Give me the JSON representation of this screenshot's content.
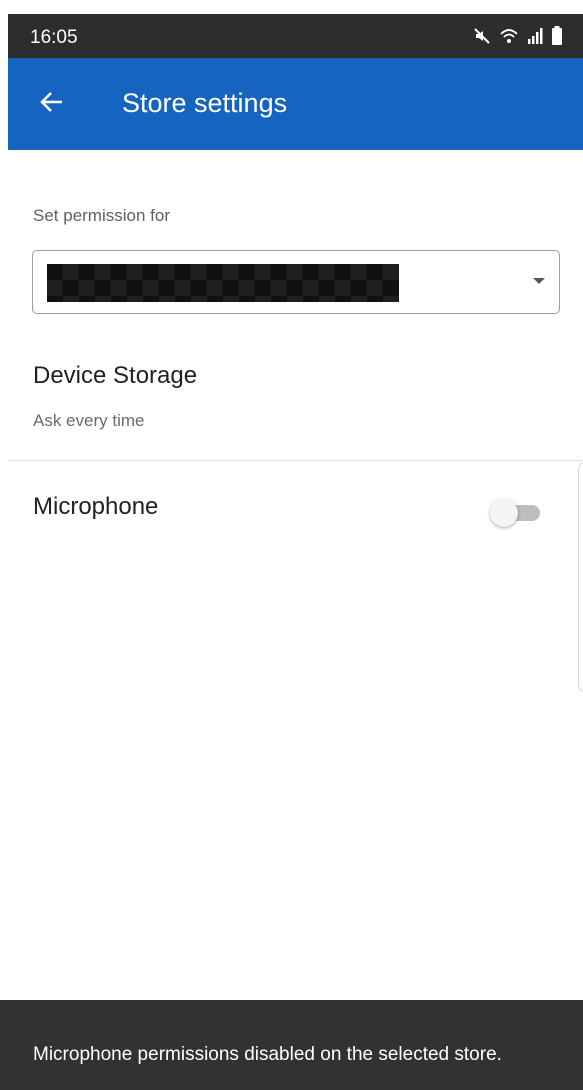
{
  "status_bar": {
    "time": "16:05",
    "icons": [
      "mute-icon",
      "wifi-icon",
      "signal-icon",
      "battery-icon"
    ]
  },
  "app_bar": {
    "title": "Store settings",
    "back_icon": "arrow-back-icon",
    "color": "#1565c0"
  },
  "permission": {
    "label": "Set permission for",
    "selected_store": "",
    "selected_store_redacted": true
  },
  "settings": {
    "device_storage": {
      "title": "Device Storage",
      "value": "Ask every time"
    },
    "microphone": {
      "title": "Microphone",
      "enabled": false
    }
  },
  "snackbar": {
    "message": "Microphone permissions disabled on the selected store."
  }
}
